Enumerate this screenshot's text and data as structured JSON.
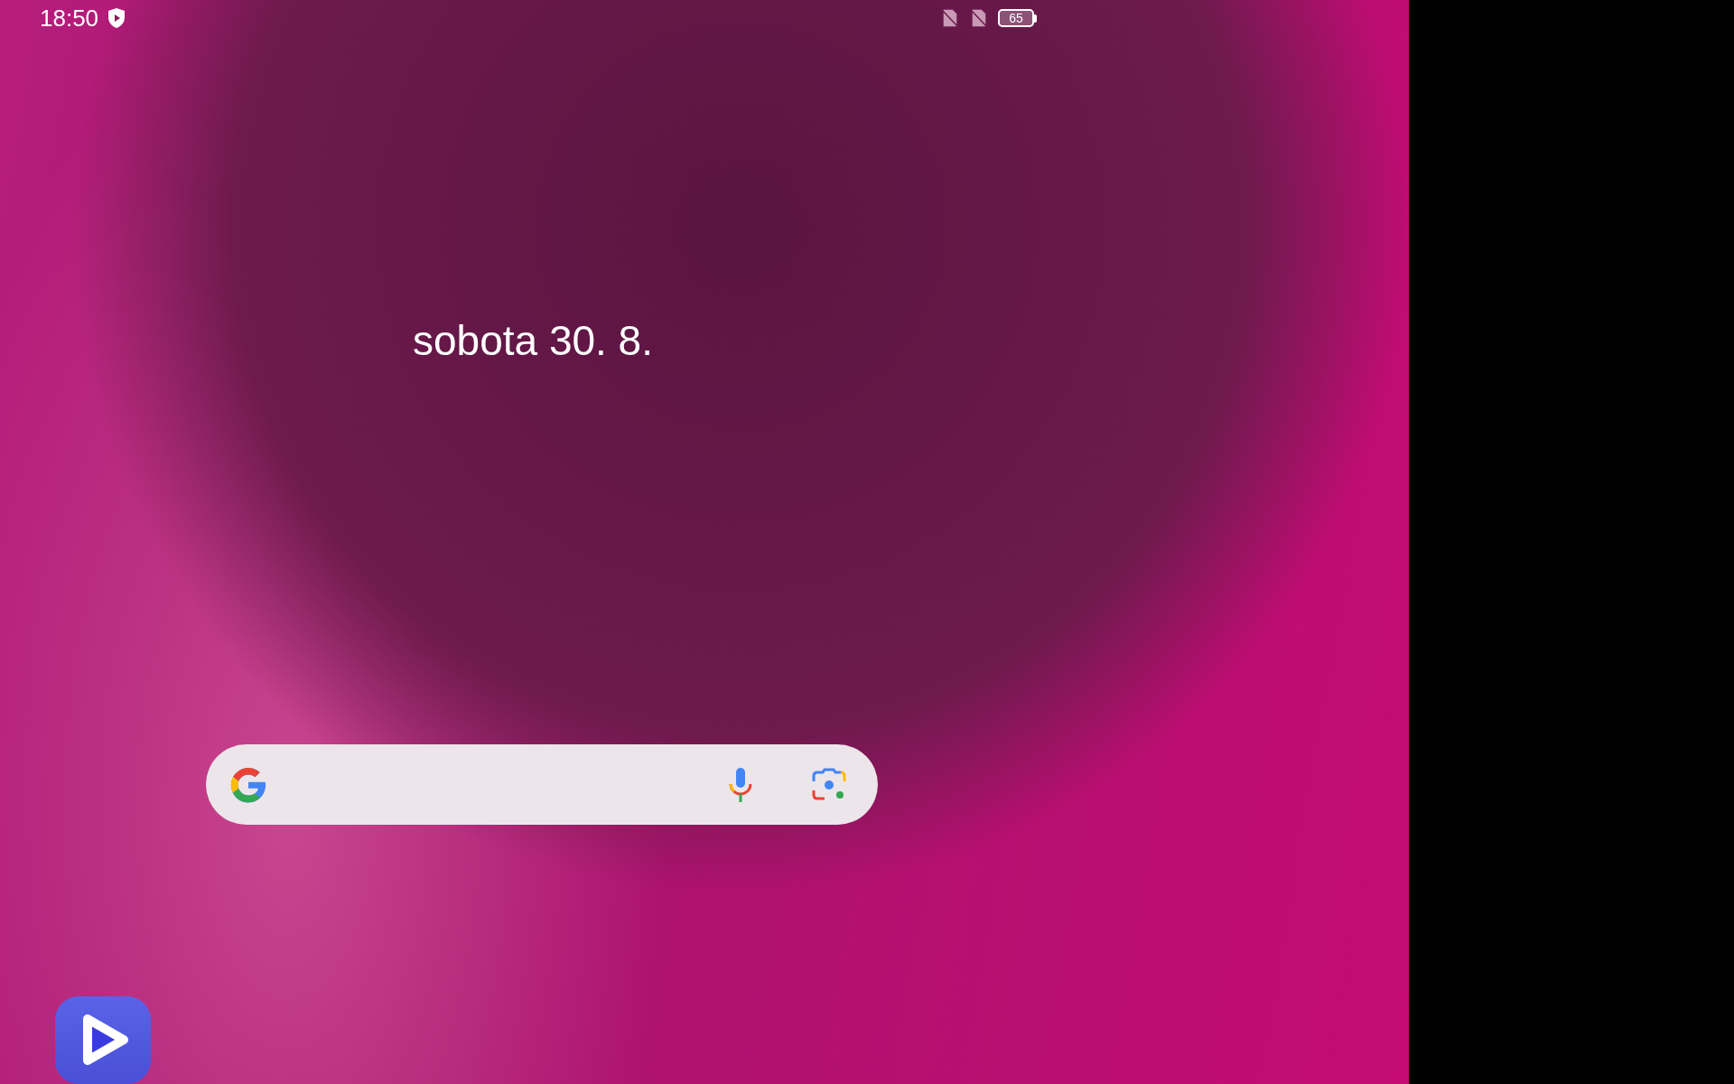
{
  "status_bar": {
    "time": "18:50",
    "battery": "65"
  },
  "date": "sobota 30. 8."
}
